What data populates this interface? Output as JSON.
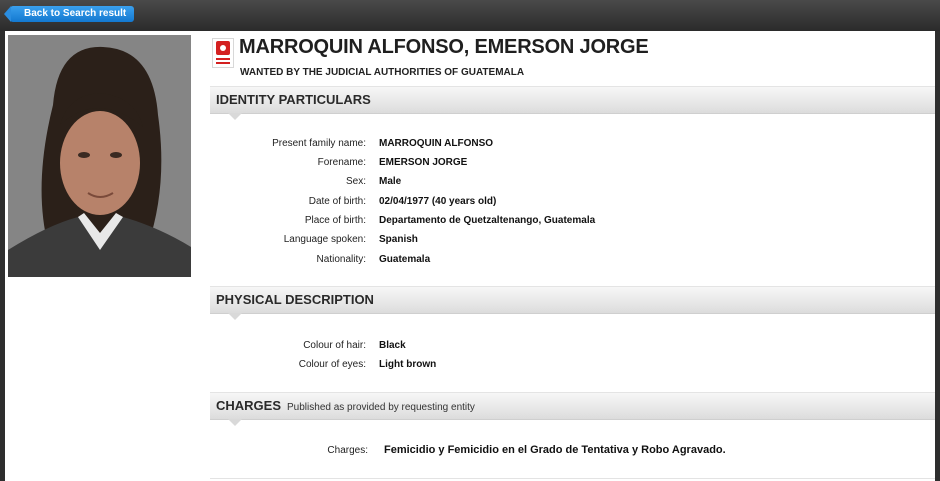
{
  "nav": {
    "back_label": "Back to Search result"
  },
  "header": {
    "name": "MARROQUIN ALFONSO, EMERSON JORGE",
    "wanted_by": "WANTED BY THE JUDICIAL AUTHORITIES OF GUATEMALA"
  },
  "identity": {
    "title": "IDENTITY PARTICULARS",
    "fields": [
      {
        "label": "Present family name:",
        "value": "MARROQUIN ALFONSO"
      },
      {
        "label": "Forename:",
        "value": "EMERSON JORGE"
      },
      {
        "label": "Sex:",
        "value": "Male"
      },
      {
        "label": "Date of birth:",
        "value": "02/04/1977 (40 years old)"
      },
      {
        "label": "Place of birth:",
        "value": "Departamento de Quetzaltenango, Guatemala"
      },
      {
        "label": "Language spoken:",
        "value": "Spanish"
      },
      {
        "label": "Nationality:",
        "value": "Guatemala"
      }
    ]
  },
  "physical": {
    "title": "PHYSICAL DESCRIPTION",
    "fields": [
      {
        "label": "Colour of hair:",
        "value": "Black"
      },
      {
        "label": "Colour of eyes:",
        "value": "Light brown"
      }
    ]
  },
  "charges": {
    "title": "CHARGES",
    "subtitle": "Published as provided by requesting entity",
    "label": "Charges:",
    "value": "Femicidio y Femicidio en el Grado de Tentativa y Robo Agravado."
  },
  "icons": {
    "back": "back-arrow-icon",
    "logo": "interpol-logo-icon"
  },
  "colors": {
    "accent": "#1a84d8",
    "topbar": "#3a3a3a"
  }
}
